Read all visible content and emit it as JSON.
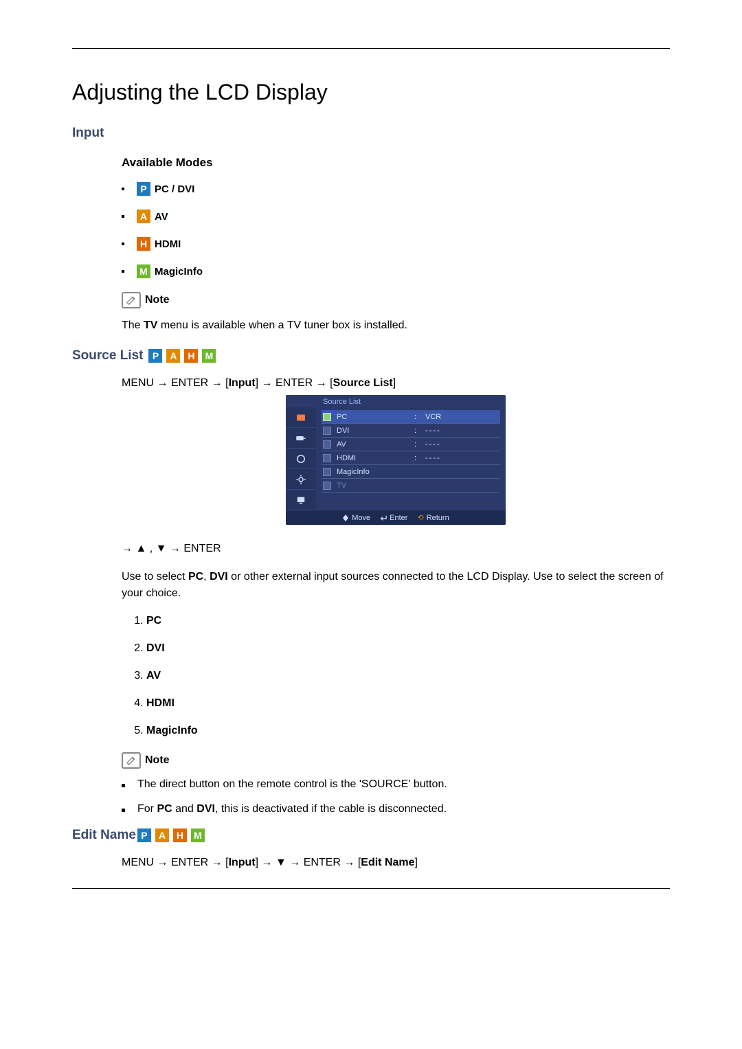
{
  "title": "Adjusting the LCD Display",
  "input_section": {
    "heading": "Input",
    "available_modes_heading": "Available Modes",
    "modes": [
      {
        "badge": "P",
        "label": "PC / DVI"
      },
      {
        "badge": "A",
        "label": "AV"
      },
      {
        "badge": "H",
        "label": "HDMI"
      },
      {
        "badge": "M",
        "label": "MagicInfo"
      }
    ],
    "note_label": "Note",
    "note_body_pre": "The ",
    "note_body_bold": "TV",
    "note_body_post": " menu is available when a TV tuner box is installed."
  },
  "source_list": {
    "heading": "Source List",
    "menu_path": {
      "p1": "MENU → ENTER → [",
      "p2": "Input",
      "p3": "] → ENTER → [",
      "p4": "Source List",
      "p5": "]"
    },
    "osd": {
      "title": "Source List",
      "rows": [
        {
          "name": "PC",
          "value": "VCR",
          "selected": true,
          "dim": false
        },
        {
          "name": "DVI",
          "value": "----",
          "selected": false,
          "dim": false
        },
        {
          "name": "AV",
          "value": "----",
          "selected": false,
          "dim": false
        },
        {
          "name": "HDMI",
          "value": "----",
          "selected": false,
          "dim": false
        },
        {
          "name": "MagicInfo",
          "value": "",
          "selected": false,
          "dim": false
        },
        {
          "name": "TV",
          "value": "",
          "selected": false,
          "dim": true
        }
      ],
      "footer": {
        "move": "Move",
        "enter": "Enter",
        "return": "Return"
      }
    },
    "nav_keys": "→ ▲ , ▼ → ENTER",
    "desc_pre": "Use to select ",
    "desc_b1": "PC",
    "desc_mid1": ", ",
    "desc_b2": "DVI",
    "desc_post": " or other external input sources connected to the LCD Display. Use to select the screen of your choice.",
    "numbered": [
      "PC",
      "DVI",
      "AV",
      "HDMI",
      "MagicInfo"
    ],
    "note_label": "Note",
    "note_bullets": [
      "The direct button on the remote control is the 'SOURCE' button.",
      {
        "pre": "For ",
        "b1": "PC",
        "mid": " and ",
        "b2": "DVI",
        "post": ", this is deactivated if the cable is disconnected."
      }
    ]
  },
  "edit_name": {
    "heading": "Edit Name",
    "menu_path": {
      "p1": "MENU → ENTER → [",
      "p2": "Input",
      "p3": "] → ▼ → ENTER → [",
      "p4": "Edit Name",
      "p5": "]"
    }
  }
}
